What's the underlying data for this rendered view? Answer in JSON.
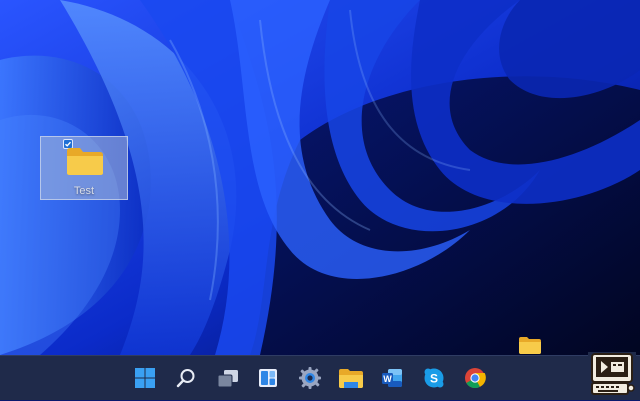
{
  "desktop": {
    "icon": {
      "label": "Test",
      "selected": true,
      "icon": "folder-icon"
    }
  },
  "taskbar": {
    "items": [
      {
        "name": "start-button",
        "icon": "windows-logo-icon"
      },
      {
        "name": "search-button",
        "icon": "search-icon"
      },
      {
        "name": "task-view-button",
        "icon": "task-view-icon"
      },
      {
        "name": "widgets-button",
        "icon": "widgets-icon"
      },
      {
        "name": "settings-button",
        "icon": "gear-icon"
      },
      {
        "name": "file-explorer-button",
        "icon": "folder-icon"
      },
      {
        "name": "word-button",
        "icon": "word-icon",
        "letter": "W"
      },
      {
        "name": "skype-button",
        "icon": "skype-icon",
        "letter": "S"
      },
      {
        "name": "chrome-button",
        "icon": "chrome-icon"
      }
    ]
  },
  "drag_ghost": {
    "icon": "folder-icon",
    "status_icon": "no-entry-icon"
  },
  "colors": {
    "taskbar": "#1f2a4a",
    "folder": "#f5c842",
    "accent": "#1f6fd6"
  }
}
